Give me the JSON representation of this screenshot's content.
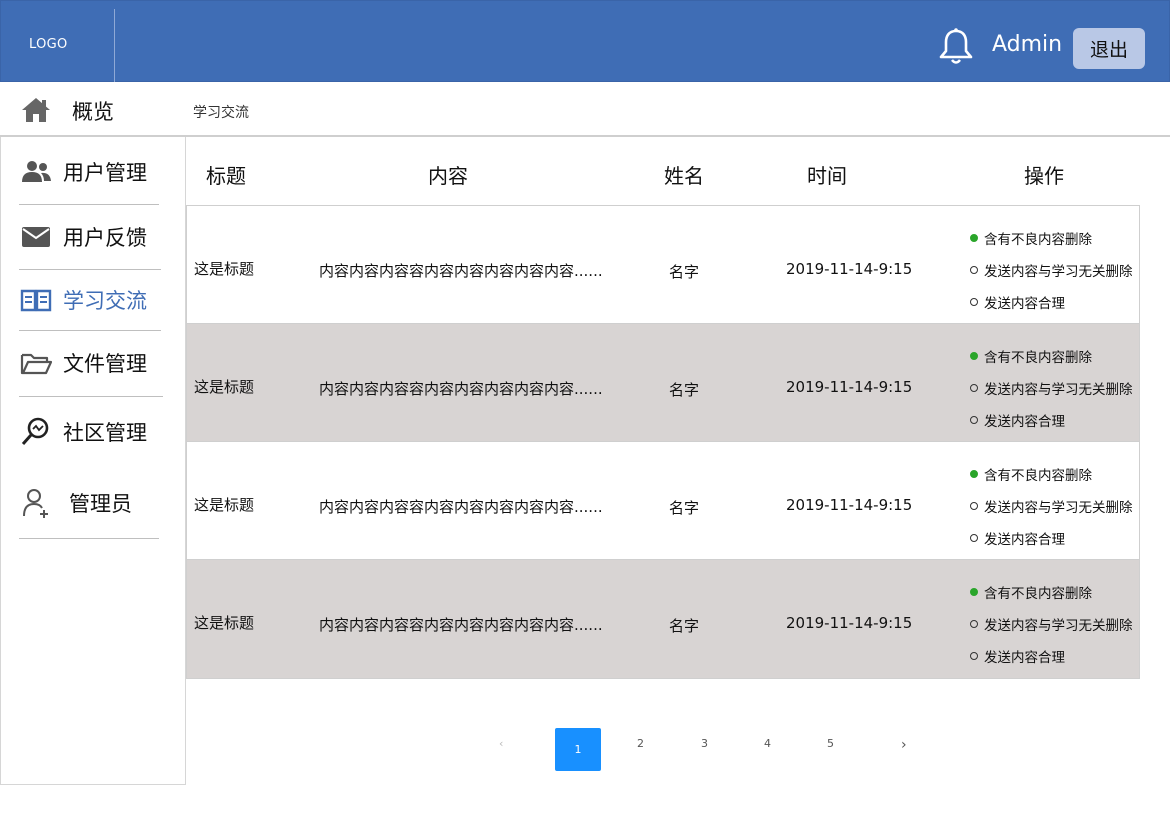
{
  "header": {
    "logo": "LOGO",
    "user": "Admin",
    "logout_label": "退出"
  },
  "breadcrumb": {
    "home_label": "概览",
    "current": "学习交流"
  },
  "sidebar": {
    "items": [
      {
        "label": "用户管理",
        "icon": "users-icon"
      },
      {
        "label": "用户反馈",
        "icon": "mail-icon"
      },
      {
        "label": "学习交流",
        "icon": "book-icon",
        "active": true
      },
      {
        "label": "文件管理",
        "icon": "folder-icon"
      },
      {
        "label": "社区管理",
        "icon": "search-icon"
      },
      {
        "label": "管理员",
        "icon": "add-user-icon"
      }
    ]
  },
  "table": {
    "columns": [
      "标题",
      "内容",
      "姓名",
      "时间",
      "操作"
    ],
    "rows": [
      {
        "title": "这是标题",
        "content": "内容内容内容容内容内容内容内容内容......",
        "name": "名字",
        "time": "2019-11-14-9:15"
      },
      {
        "title": "这是标题",
        "content": "内容内容内容容内容内容内容内容内容......",
        "name": "名字",
        "time": "2019-11-14-9:15"
      },
      {
        "title": "这是标题",
        "content": "内容内容内容容内容内容内容内容内容......",
        "name": "名字",
        "time": "2019-11-14-9:15"
      },
      {
        "title": "这是标题",
        "content": "内容内容内容容内容内容内容内容内容......",
        "name": "名字",
        "time": "2019-11-14-9:15"
      }
    ],
    "actions": [
      "含有不良内容删除",
      "发送内容与学习无关删除",
      "发送内容合理"
    ],
    "selected_action": "含有不良内容删除"
  },
  "pagination": {
    "prev": "‹",
    "pages": [
      "1",
      "2",
      "3",
      "4",
      "5"
    ],
    "current": "1",
    "next": "›"
  },
  "colors": {
    "header_bg": "#3f6db5",
    "active_nav": "#3f6db5",
    "row_alt": "#d8d4d3",
    "page_active": "#1890ff",
    "check": "#2aa52a"
  }
}
